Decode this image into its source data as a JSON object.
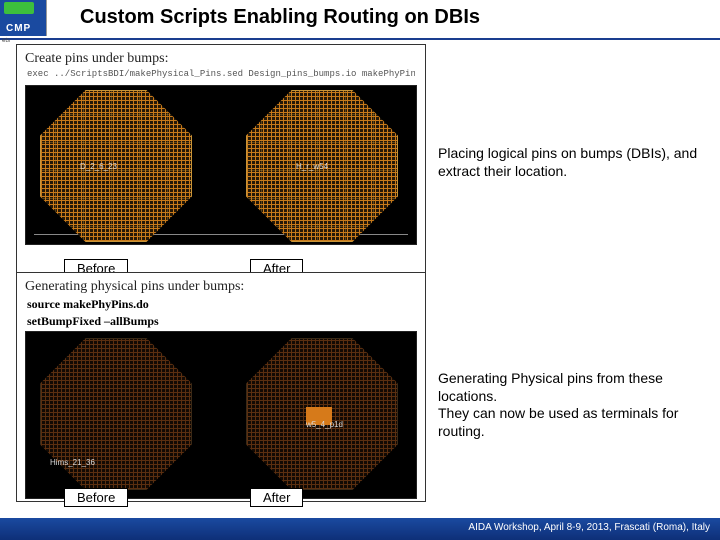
{
  "header": {
    "logo_text": "CMP",
    "title": "Custom Scripts Enabling Routing on DBIs",
    "tiny_side_text": "ets"
  },
  "panel_top": {
    "heading": "Create pins under bumps:",
    "command": "exec ../ScriptsBDI/makePhysical_Pins.sed Design_pins_bumps.io makePhyPins.do",
    "before_label": "Before",
    "after_label": "After",
    "left_pin_label": "D_2_6_23",
    "right_pin_label": "H_r_w54"
  },
  "panel_bottom": {
    "heading": "Generating physical pins under bumps:",
    "command1": "source makePhyPins.do",
    "command2": "setBumpFixed –allBumps",
    "before_label": "Before",
    "after_label": "After",
    "left_pin_label": "Hims_21_36",
    "right_pin_label": "w5_4_p1d"
  },
  "caption_top": "Placing logical pins on bumps (DBIs), and extract their location.",
  "caption_bottom": "Generating Physical pins from these locations.\nThey can now be used as terminals for routing.",
  "footer": "AIDA Workshop, April 8-9, 2013, Frascati (Roma), Italy"
}
